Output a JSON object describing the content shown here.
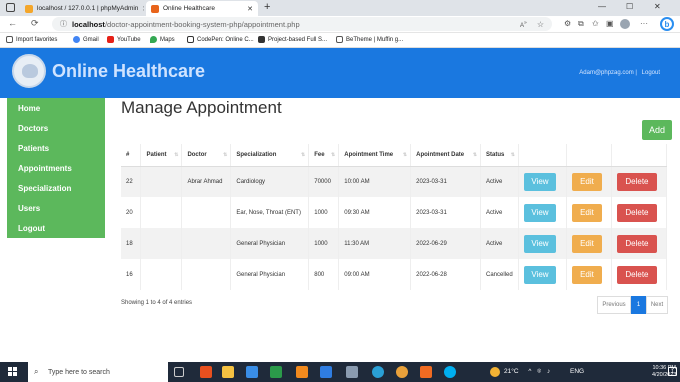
{
  "browser": {
    "tabs": [
      {
        "label": "localhost / 127.0.0.1 | phpMyAdmin"
      },
      {
        "label": "Online Healthcare"
      }
    ],
    "new_tab": "+",
    "url_host": "localhost",
    "url_path": "/doctor-appointment-booking-system-php/appointment.php",
    "favorites": [
      "Import favorites",
      "Gmail",
      "YouTube",
      "Maps",
      "CodePen: Online C...",
      "Project-based Full S...",
      "BeTheme | Muffin g..."
    ]
  },
  "app": {
    "brand": "Online Healthcare",
    "user_email": "Adam@phpzag.com",
    "separator": "|",
    "logout_link": "Logout"
  },
  "sidebar": {
    "items": [
      "Home",
      "Doctors",
      "Patients",
      "Appointments",
      "Specialization",
      "Users",
      "Logout"
    ]
  },
  "main": {
    "title": "Manage Appointment",
    "add_label": "Add",
    "columns": [
      "#",
      "Patient",
      "Doctor",
      "Specialization",
      "Fee",
      "Apointment Time",
      "Apointment Date",
      "Status"
    ],
    "rows": [
      {
        "id": "22",
        "patient": "",
        "doctor": "Abrar Ahmad",
        "specialization": "Cardiology",
        "fee": "70000",
        "time": "10:00 AM",
        "date": "2023-03-31",
        "status": "Active"
      },
      {
        "id": "20",
        "patient": "",
        "doctor": "",
        "specialization": "Ear, Nose, Throat (ENT)",
        "fee": "1000",
        "time": "09:30 AM",
        "date": "2023-03-31",
        "status": "Active"
      },
      {
        "id": "18",
        "patient": "",
        "doctor": "",
        "specialization": "General Physician",
        "fee": "1000",
        "time": "11:30 AM",
        "date": "2022-06-29",
        "status": "Active"
      },
      {
        "id": "16",
        "patient": "",
        "doctor": "",
        "specialization": "General Physician",
        "fee": "800",
        "time": "09:00 AM",
        "date": "2022-06-28",
        "status": "Cancelled"
      }
    ],
    "view_label": "View",
    "edit_label": "Edit",
    "delete_label": "Delete",
    "entries_info": "Showing 1 to 4 of 4 entries",
    "pager": {
      "previous": "Previous",
      "current": "1",
      "next": "Next"
    }
  },
  "taskbar": {
    "search_placeholder": "Type here to search",
    "weather": "21°C",
    "lang": "ENG",
    "time": "10:36 PM",
    "date": "4/20/2023",
    "notifications": "1"
  },
  "colors": {
    "header": "#1a78e0",
    "sidebar": "#5cb85c",
    "view": "#5bc0de",
    "edit": "#f0ad4e",
    "delete": "#d9534f"
  }
}
